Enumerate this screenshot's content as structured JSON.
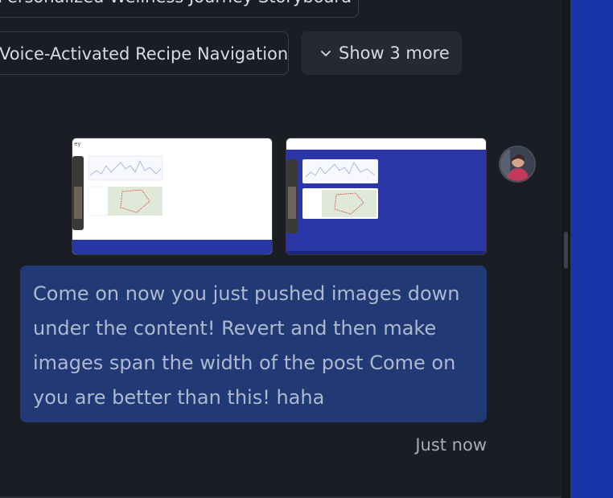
{
  "suggestions": {
    "top_partial": "Personalized Wellness Journey Storyboard",
    "voice": "Voice-Activated Recipe Navigation",
    "show_more": "Show 3 more"
  },
  "message": {
    "text": "Come on now you just pushed images down under the content! Revert and then make images span the width of the post Come on you are better than this! haha",
    "timestamp": "Just now"
  },
  "attachments": [
    {
      "kind": "screenshot",
      "theme": "light"
    },
    {
      "kind": "screenshot",
      "theme": "blue"
    }
  ],
  "colors": {
    "background": "#1b1d24",
    "bubble": "#213a75",
    "accent_panel": "#1a35a8",
    "chip_border": "#3a3d47"
  },
  "icons": {
    "show_more": "chevron-down-icon"
  }
}
